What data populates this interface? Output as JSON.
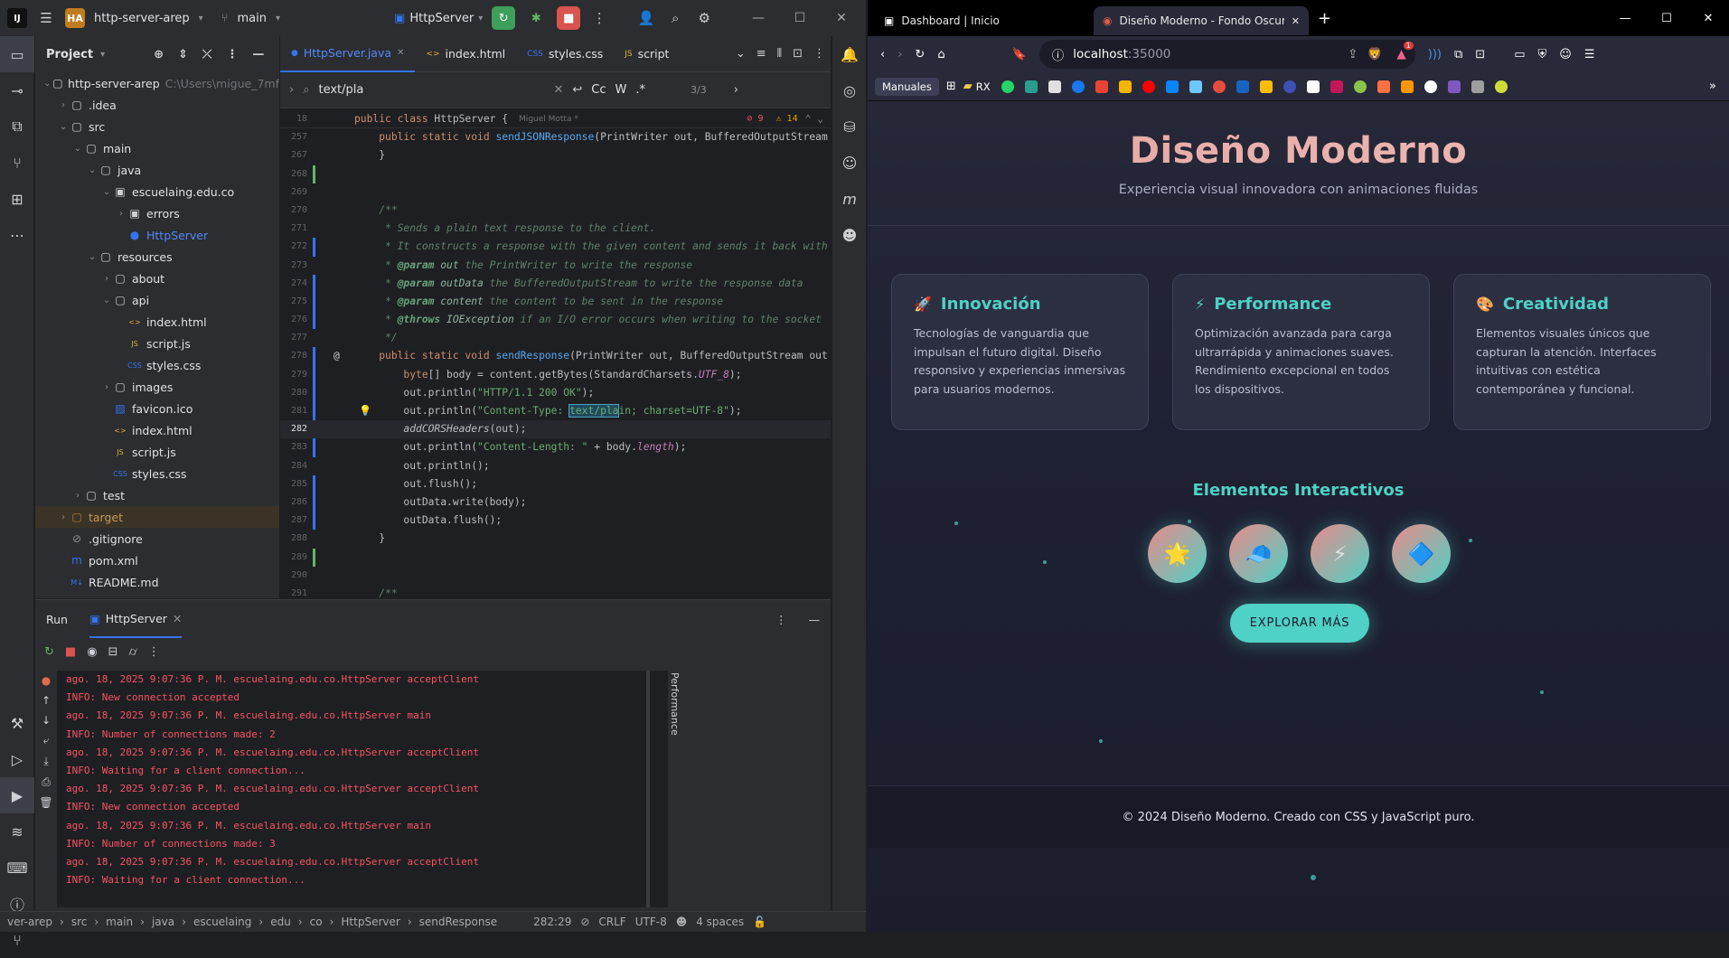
{
  "ide": {
    "project_badge": "HA",
    "project_name": "http-server-arep",
    "branch": "main",
    "run_config": "HttpServer",
    "project_panel_title": "Project",
    "tree": [
      {
        "label": "http-server-arep",
        "extra": "C:\\Users\\migue_7mf",
        "depth": 0,
        "icon": "folder",
        "arrow": "v"
      },
      {
        "label": ".idea",
        "depth": 1,
        "icon": "folder",
        "arrow": ">"
      },
      {
        "label": "src",
        "depth": 1,
        "icon": "folder",
        "arrow": "v"
      },
      {
        "label": "main",
        "depth": 2,
        "icon": "folder",
        "arrow": "v"
      },
      {
        "label": "java",
        "depth": 3,
        "icon": "folder",
        "arrow": "v"
      },
      {
        "label": "escuelaing.edu.co",
        "depth": 4,
        "icon": "package",
        "arrow": "v"
      },
      {
        "label": "errors",
        "depth": 5,
        "icon": "package",
        "arrow": ">"
      },
      {
        "label": "HttpServer",
        "depth": 5,
        "icon": "class",
        "arrow": ""
      },
      {
        "label": "resources",
        "depth": 3,
        "icon": "folder",
        "arrow": "v"
      },
      {
        "label": "about",
        "depth": 4,
        "icon": "folder",
        "arrow": ">"
      },
      {
        "label": "api",
        "depth": 4,
        "icon": "folder",
        "arrow": "v"
      },
      {
        "label": "index.html",
        "depth": 5,
        "icon": "html",
        "arrow": ""
      },
      {
        "label": "script.js",
        "depth": 5,
        "icon": "js",
        "arrow": ""
      },
      {
        "label": "styles.css",
        "depth": 5,
        "icon": "css",
        "arrow": ""
      },
      {
        "label": "images",
        "depth": 4,
        "icon": "folder",
        "arrow": ">"
      },
      {
        "label": "favicon.ico",
        "depth": 4,
        "icon": "image",
        "arrow": ""
      },
      {
        "label": "index.html",
        "depth": 4,
        "icon": "html",
        "arrow": ""
      },
      {
        "label": "script.js",
        "depth": 4,
        "icon": "js",
        "arrow": ""
      },
      {
        "label": "styles.css",
        "depth": 4,
        "icon": "css",
        "arrow": ""
      },
      {
        "label": "test",
        "depth": 2,
        "icon": "folder",
        "arrow": ">"
      },
      {
        "label": "target",
        "depth": 1,
        "icon": "folder-orange",
        "arrow": ">"
      },
      {
        "label": ".gitignore",
        "depth": 1,
        "icon": "ignore",
        "arrow": ""
      },
      {
        "label": "pom.xml",
        "depth": 1,
        "icon": "maven",
        "arrow": ""
      },
      {
        "label": "README.md",
        "depth": 1,
        "icon": "md",
        "arrow": ""
      }
    ],
    "tabs": [
      {
        "label": "HttpServer.java",
        "active": true,
        "closable": true
      },
      {
        "label": "index.html",
        "active": false,
        "closable": false
      },
      {
        "label": "styles.css",
        "active": false,
        "closable": false
      },
      {
        "label": "script",
        "active": false,
        "closable": false
      }
    ],
    "search": {
      "query": "text/pla",
      "match_count": "3/3",
      "case_label": "Cc",
      "word_label": "W",
      "regex_label": ".*"
    },
    "sticky": {
      "line": "18",
      "code": "public class HttpServer {",
      "author": "Miguel Motta *",
      "warnings": "9",
      "weak_warnings": "14"
    },
    "code_lines": [
      {
        "n": "257",
        "html": "    <span class='kw'>public static void</span> <span class='fn'>sendJSONResponse</span>(PrintWriter out, BufferedOutputStream"
      },
      {
        "n": "267",
        "html": "    }"
      },
      {
        "n": "268",
        "html": ""
      },
      {
        "n": "269",
        "html": ""
      },
      {
        "n": "270",
        "html": "    <span class='cm'>/**</span>"
      },
      {
        "n": "271",
        "html": "<span class='cm'>     * Sends a plain text response to the client.</span>"
      },
      {
        "n": "272",
        "html": "<span class='cm'>     * It constructs a response with the given content and sends it back with</span>"
      },
      {
        "n": "273",
        "html": "<span class='cm'>     * </span><span class='cmt'>@param</span><span class='cm'> </span><span class='cm' style='color:#8fb5a0'>out</span><span class='cm'> the PrintWriter to write the response</span>"
      },
      {
        "n": "274",
        "html": "<span class='cm'>     * </span><span class='cmt'>@param</span><span class='cm'> </span><span class='cm' style='color:#8fb5a0'>outData</span><span class='cm'> the BufferedOutputStream to write the response data</span>"
      },
      {
        "n": "275",
        "html": "<span class='cm'>     * </span><span class='cmt'>@param</span><span class='cm'> </span><span class='cm' style='color:#8fb5a0'>content</span><span class='cm'> the content to be sent in the response</span>"
      },
      {
        "n": "276",
        "html": "<span class='cm'>     * </span><span class='cmt'>@throws</span><span class='cm'> </span><span class='cm' style='color:#8fb5a0'>IOException</span><span class='cm'> if an I/O error occurs when writing to the socket</span>"
      },
      {
        "n": "277",
        "html": "<span class='cm'>     */</span>"
      },
      {
        "n": "278",
        "html": "    <span class='kw'>public static void</span> <span class='fn'>sendResponse</span>(PrintWriter out, BufferedOutputStream out"
      },
      {
        "n": "279",
        "html": "        <span class='kw'>byte</span>[] body = content.getBytes(StandardCharsets.<span class='it'>UTF_8</span>);"
      },
      {
        "n": "280",
        "html": "        out.println(<span class='str'>\"HTTP/1.1 200 OK\"</span>);"
      },
      {
        "n": "281",
        "html": "        out.println(<span class='str'>\"Content-Type: <span style='background:#1f4b5c;outline:1px solid #4fa0c0'>text/pla</span>in; charset=UTF-8\"</span>);"
      },
      {
        "n": "282",
        "html": "        <span style='font-style:italic'>addCORSHeaders</span>(out);"
      },
      {
        "n": "283",
        "html": "        out.println(<span class='str'>\"Content-Length: \"</span> + body.<span class='it'>length</span>);"
      },
      {
        "n": "284",
        "html": "        out.println();"
      },
      {
        "n": "285",
        "html": "        out.flush();"
      },
      {
        "n": "286",
        "html": "        outData.write(body);"
      },
      {
        "n": "287",
        "html": "        outData.flush();"
      },
      {
        "n": "288",
        "html": "    }"
      },
      {
        "n": "289",
        "html": ""
      },
      {
        "n": "290",
        "html": ""
      },
      {
        "n": "291",
        "html": "    <span class='cm'>/**</span>"
      }
    ],
    "run": {
      "title": "Run",
      "tab": "HttpServer",
      "performance": "Performance",
      "log": [
        "ago. 18, 2025 9:07:36 P. M. escuelaing.edu.co.HttpServer acceptClient",
        "INFO: New connection accepted",
        "ago. 18, 2025 9:07:36 P. M. escuelaing.edu.co.HttpServer main",
        "INFO: Number of connections made: 2",
        "ago. 18, 2025 9:07:36 P. M. escuelaing.edu.co.HttpServer acceptClient",
        "INFO: Waiting for a client connection...",
        "ago. 18, 2025 9:07:36 P. M. escuelaing.edu.co.HttpServer acceptClient",
        "INFO: New connection accepted",
        "ago. 18, 2025 9:07:36 P. M. escuelaing.edu.co.HttpServer main",
        "INFO: Number of connections made: 3",
        "ago. 18, 2025 9:07:36 P. M. escuelaing.edu.co.HttpServer acceptClient",
        "INFO: Waiting for a client connection..."
      ]
    },
    "status": {
      "crumbs": [
        "ver-arep",
        "src",
        "main",
        "java",
        "escuelaing",
        "edu",
        "co",
        "HttpServer",
        "sendResponse"
      ],
      "position": "282:29",
      "line_sep": "CRLF",
      "encoding": "UTF-8",
      "indent": "4 spaces"
    }
  },
  "browser": {
    "tabs": [
      {
        "title": "Dashboard | Inicio",
        "active": false
      },
      {
        "title": "Diseño Moderno - Fondo Oscuro",
        "active": true
      }
    ],
    "new_tab": "+",
    "url_host": "localhost",
    "url_port": ":35000",
    "notif_count": "1",
    "bookmarks_first": "Manuales",
    "bookmarks_rx": "RX",
    "bookmark_colors": [
      "#25d366",
      "#2a9d8f",
      "#e0e0e0",
      "#1877f2",
      "#ea4335",
      "#f4b400",
      "#ff0000",
      "#0a84ff",
      "#6ec6ff",
      "#e74c3c",
      "#1565c0",
      "#fbbc05",
      "#3f51b5",
      "#ffffff",
      "#c2185b",
      "#8bc34a",
      "#ff7043",
      "#ff9800",
      "#ffffff",
      "#7e57c2",
      "#9e9e9e",
      "#cddc39"
    ]
  },
  "site": {
    "title": "Diseño Moderno",
    "subtitle": "Experiencia visual innovadora con animaciones fluidas",
    "cards": [
      {
        "icon": "🚀",
        "title": "Innovación",
        "text": "Tecnologías de vanguardia que impulsan el futuro digital. Diseño responsivo y experiencias inmersivas para usuarios modernos."
      },
      {
        "icon": "⚡",
        "title": "Performance",
        "text": "Optimización avanzada para carga ultrarrápida y animaciones suaves. Rendimiento excepcional en todos los dispositivos."
      },
      {
        "icon": "🎨",
        "title": "Creatividad",
        "text": "Elementos visuales únicos que capturan la atención. Interfaces intuitivas con estética contemporánea y funcional."
      }
    ],
    "interactive_title": "Elementos Interactivos",
    "bubbles": [
      "🌟",
      "🧢",
      "⚡",
      "🔷"
    ],
    "explore_button": "EXPLORAR MÁS",
    "footer": "© 2024 Diseño Moderno. Creado con CSS y JavaScript puro.",
    "accent": "#4fd1c5"
  }
}
